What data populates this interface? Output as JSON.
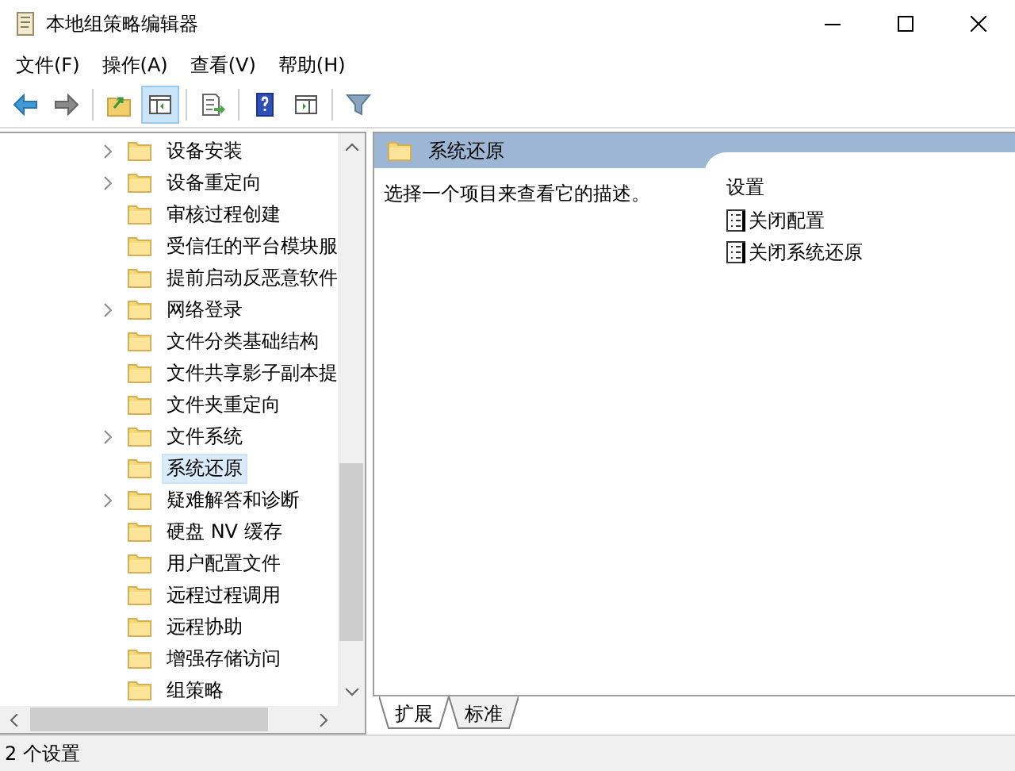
{
  "window": {
    "title": "本地组策略编辑器"
  },
  "menu": [
    "文件(F)",
    "操作(A)",
    "查看(V)",
    "帮助(H)"
  ],
  "toolbar": [
    [
      {
        "kind": "back",
        "selected": false
      },
      {
        "kind": "forward",
        "selected": false
      }
    ],
    [
      {
        "kind": "up",
        "selected": false
      },
      {
        "kind": "tree",
        "selected": true
      }
    ],
    [
      {
        "kind": "export",
        "selected": false
      }
    ],
    [
      {
        "kind": "help",
        "selected": false
      },
      {
        "kind": "pane",
        "selected": false
      }
    ],
    [
      {
        "kind": "filter",
        "selected": false
      }
    ]
  ],
  "tree": {
    "items": [
      {
        "label": "设备安装",
        "expandable": true,
        "selected": false
      },
      {
        "label": "设备重定向",
        "expandable": true,
        "selected": false
      },
      {
        "label": "审核过程创建",
        "expandable": false,
        "selected": false
      },
      {
        "label": "受信任的平台模块服",
        "expandable": false,
        "selected": false
      },
      {
        "label": "提前启动反恶意软件",
        "expandable": false,
        "selected": false
      },
      {
        "label": "网络登录",
        "expandable": true,
        "selected": false
      },
      {
        "label": "文件分类基础结构",
        "expandable": false,
        "selected": false
      },
      {
        "label": "文件共享影子副本提",
        "expandable": false,
        "selected": false
      },
      {
        "label": "文件夹重定向",
        "expandable": false,
        "selected": false
      },
      {
        "label": "文件系统",
        "expandable": true,
        "selected": false
      },
      {
        "label": "系统还原",
        "expandable": false,
        "selected": true
      },
      {
        "label": "疑难解答和诊断",
        "expandable": true,
        "selected": false
      },
      {
        "label": "硬盘 NV 缓存",
        "expandable": false,
        "selected": false
      },
      {
        "label": "用户配置文件",
        "expandable": false,
        "selected": false
      },
      {
        "label": "远程过程调用",
        "expandable": false,
        "selected": false
      },
      {
        "label": "远程协助",
        "expandable": false,
        "selected": false
      },
      {
        "label": "增强存储访问",
        "expandable": false,
        "selected": false
      },
      {
        "label": "组策略",
        "expandable": false,
        "selected": false
      }
    ]
  },
  "detail": {
    "header": "系统还原",
    "description": "选择一个项目来查看它的描述。",
    "settings_heading": "设置",
    "settings": [
      "关闭配置",
      "关闭系统还原"
    ]
  },
  "tabs": [
    {
      "label": "扩展",
      "selected": true
    },
    {
      "label": "标准",
      "selected": false
    }
  ],
  "status_bar": "2 个设置"
}
